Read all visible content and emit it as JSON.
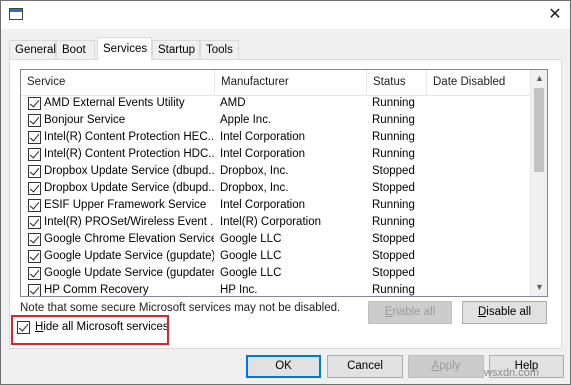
{
  "window": {
    "close_glyph": "✕"
  },
  "tabs": [
    {
      "label": "General"
    },
    {
      "label": "Boot"
    },
    {
      "label": "Services",
      "active": true
    },
    {
      "label": "Startup"
    },
    {
      "label": "Tools"
    }
  ],
  "table": {
    "columns": [
      "Service",
      "Manufacturer",
      "Status",
      "Date Disabled"
    ],
    "rows": [
      {
        "service": "AMD External Events Utility",
        "manufacturer": "AMD",
        "status": "Running",
        "checked": true
      },
      {
        "service": "Bonjour Service",
        "manufacturer": "Apple Inc.",
        "status": "Running",
        "checked": true
      },
      {
        "service": "Intel(R) Content Protection HEC...",
        "manufacturer": "Intel Corporation",
        "status": "Running",
        "checked": true
      },
      {
        "service": "Intel(R) Content Protection HDC...",
        "manufacturer": "Intel Corporation",
        "status": "Running",
        "checked": true
      },
      {
        "service": "Dropbox Update Service (dbupd...",
        "manufacturer": "Dropbox, Inc.",
        "status": "Stopped",
        "checked": true
      },
      {
        "service": "Dropbox Update Service (dbupd...",
        "manufacturer": "Dropbox, Inc.",
        "status": "Stopped",
        "checked": true
      },
      {
        "service": "ESIF Upper Framework Service",
        "manufacturer": "Intel Corporation",
        "status": "Running",
        "checked": true
      },
      {
        "service": "Intel(R) PROSet/Wireless Event ...",
        "manufacturer": "Intel(R) Corporation",
        "status": "Running",
        "checked": true
      },
      {
        "service": "Google Chrome Elevation Service",
        "manufacturer": "Google LLC",
        "status": "Stopped",
        "checked": true
      },
      {
        "service": "Google Update Service (gupdate)",
        "manufacturer": "Google LLC",
        "status": "Stopped",
        "checked": true
      },
      {
        "service": "Google Update Service (gupdatem)",
        "manufacturer": "Google LLC",
        "status": "Stopped",
        "checked": true
      },
      {
        "service": "HP Comm Recovery",
        "manufacturer": "HP Inc.",
        "status": "Running",
        "checked": true
      }
    ]
  },
  "note": "Note that some secure Microsoft services may not be disabled.",
  "buttons": {
    "enable_all": {
      "mnemonic": "E",
      "rest": "nable all",
      "enabled": false
    },
    "disable_all": {
      "mnemonic": "D",
      "rest": "isable all",
      "enabled": true
    },
    "ok": "OK",
    "cancel": "Cancel",
    "apply": {
      "mnemonic": "A",
      "rest": "pply",
      "enabled": false
    },
    "help": "Help"
  },
  "hide_ms": {
    "mnemonic": "H",
    "rest": "ide all Microsoft services",
    "checked": true
  },
  "watermark": "wsxdn.com",
  "colors": {
    "highlight_border": "#d9252a",
    "accent": "#0078d7"
  }
}
